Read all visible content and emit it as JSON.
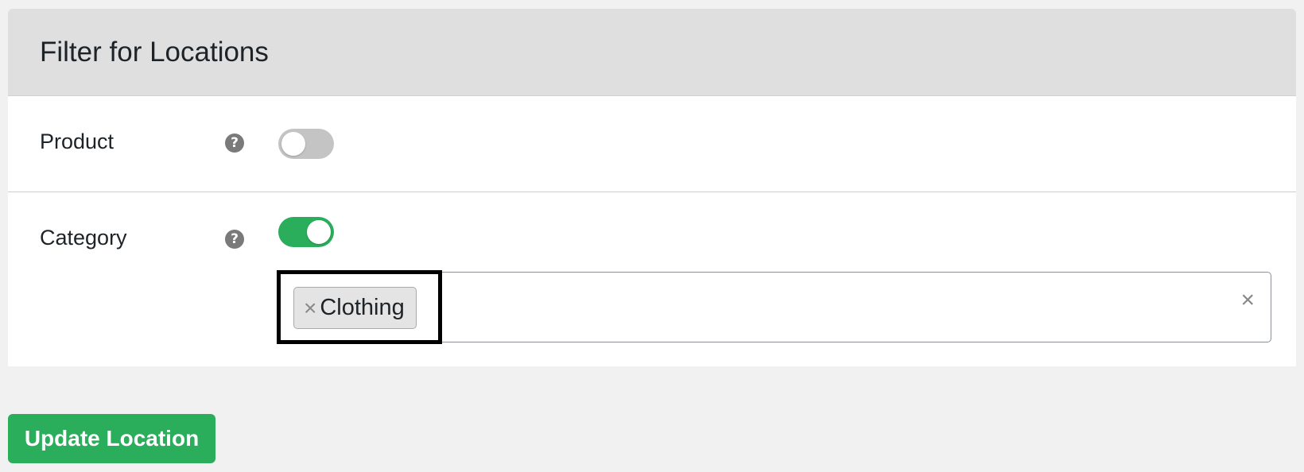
{
  "panel": {
    "title": "Filter for Locations"
  },
  "filters": {
    "product": {
      "label": "Product",
      "help_icon": "?",
      "enabled": false
    },
    "category": {
      "label": "Category",
      "help_icon": "?",
      "enabled": true,
      "selected_tags": [
        {
          "label": "Clothing",
          "remove_glyph": "×"
        }
      ],
      "clear_glyph": "×"
    }
  },
  "actions": {
    "update_label": "Update Location"
  },
  "colors": {
    "accent": "#2aae5b",
    "toggle_off": "#c4c4c4",
    "header_bg": "#dfdfdf",
    "page_bg": "#f1f1f1"
  },
  "icons": {
    "help": "question-circle-icon",
    "tag_remove": "close-icon",
    "clear_all": "close-icon"
  }
}
